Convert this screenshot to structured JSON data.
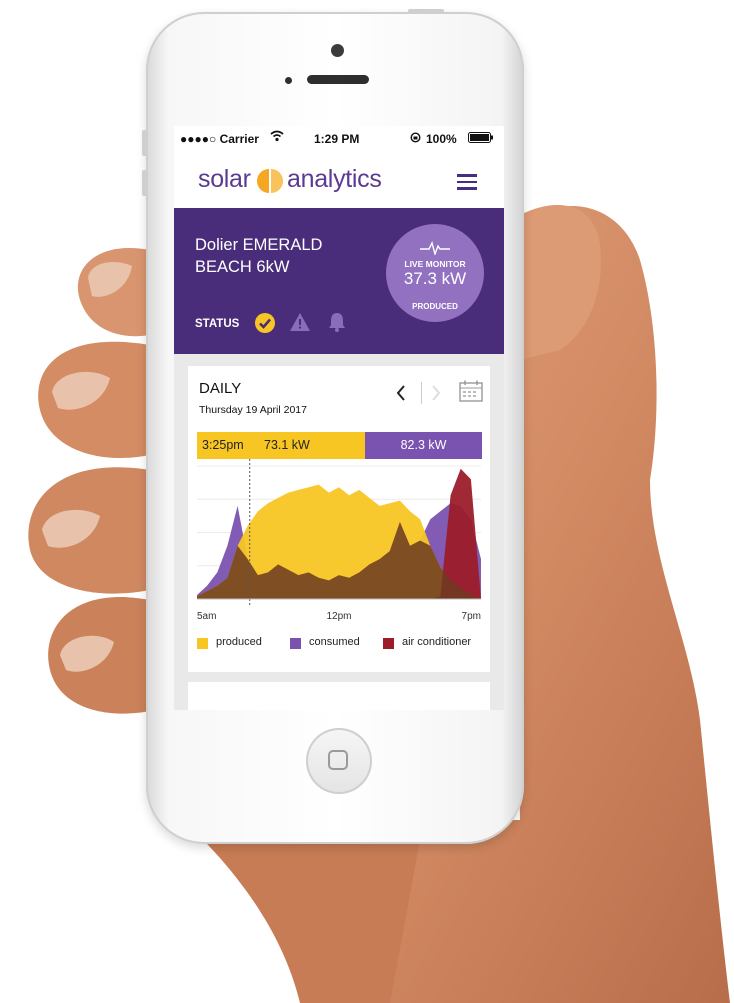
{
  "status_bar": {
    "carrier": "●●●●○ Carrier",
    "time": "1:29 PM",
    "battery": "100%",
    "wifi_icon": "wifi-icon",
    "lock_icon": "rotation-lock-icon"
  },
  "header": {
    "logo_left": "solar",
    "logo_right": "analytics",
    "menu_icon": "hamburger-menu-icon"
  },
  "site": {
    "name_line1": "Dolier EMERALD",
    "name_line2": "BEACH 6kW",
    "status_label": "STATUS",
    "status_icons": [
      "check-circle-icon",
      "warning-icon",
      "bell-icon"
    ]
  },
  "live_monitor": {
    "label": "LIVE MONITOR",
    "value": "37.3 kW",
    "sublabel": "PRODUCED"
  },
  "daily": {
    "title": "DAILY",
    "date": "Thursday 19 April 2017",
    "tooltip_time": "3:25pm",
    "tooltip_produced": "73.1 kW",
    "tooltip_consumed": "82.3 kW"
  },
  "colors": {
    "purple_header": "#4a2d7a",
    "produced": "#f8c623",
    "consumed": "#7a52b0",
    "air_conditioner": "#9b1d2a"
  },
  "chart_data": {
    "type": "area",
    "x_tick_labels": [
      "5am",
      "12pm",
      "7pm"
    ],
    "x": [
      5,
      5.5,
      6,
      6.5,
      7,
      7.5,
      8,
      8.5,
      9,
      9.5,
      10,
      10.5,
      11,
      11.5,
      12,
      12.5,
      13,
      13.5,
      14,
      14.5,
      15,
      15.5,
      16,
      16.5,
      17,
      17.5,
      18,
      18.5,
      19
    ],
    "series": [
      {
        "name": "produced",
        "values": [
          2,
          6,
          10,
          16,
          40,
          55,
          66,
          72,
          76,
          80,
          82,
          84,
          86,
          80,
          84,
          78,
          82,
          76,
          70,
          72,
          74,
          66,
          60,
          40,
          24,
          14,
          8,
          3,
          0
        ]
      },
      {
        "name": "consumed",
        "values": [
          3,
          10,
          20,
          40,
          70,
          30,
          18,
          20,
          26,
          22,
          18,
          20,
          16,
          14,
          18,
          16,
          20,
          26,
          30,
          36,
          58,
          40,
          44,
          60,
          66,
          72,
          70,
          60,
          30
        ]
      },
      {
        "name": "air conditioner",
        "values": [
          0,
          0,
          0,
          0,
          0,
          0,
          0,
          0,
          0,
          0,
          0,
          0,
          0,
          0,
          0,
          0,
          0,
          0,
          0,
          0,
          0,
          0,
          0,
          0,
          2,
          78,
          98,
          90,
          0
        ]
      }
    ],
    "grid": true,
    "legend_position": "bottom"
  }
}
